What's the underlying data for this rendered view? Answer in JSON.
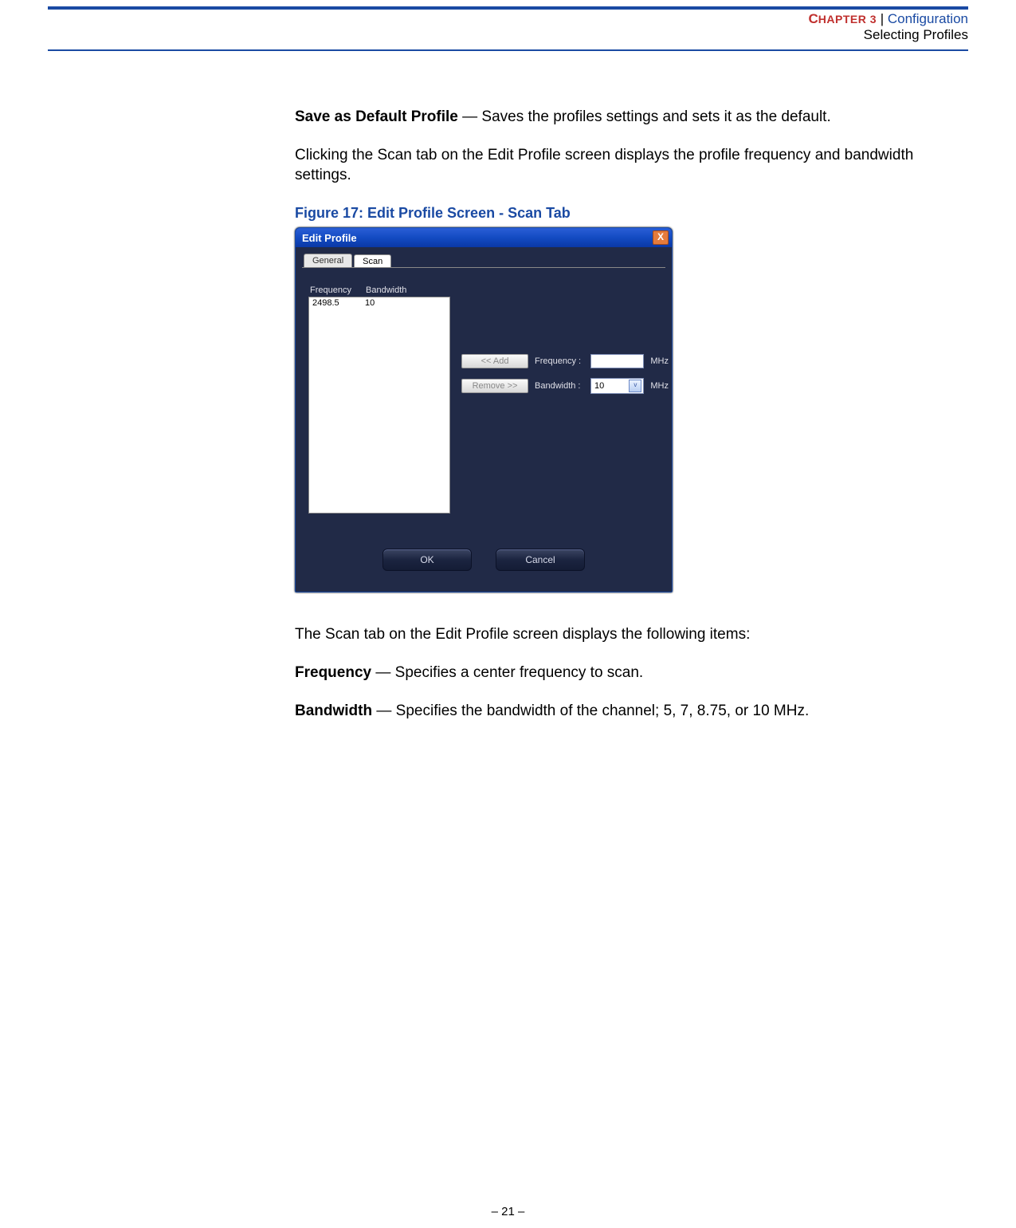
{
  "header": {
    "chapter_word": "C",
    "chapter_rest": "HAPTER 3",
    "sep": "  |  ",
    "config": "Configuration",
    "subtitle": "Selecting Profiles"
  },
  "body": {
    "save_default_term": "Save as Default Profile",
    "save_default_rest": " — Saves the profiles settings and sets it as the default.",
    "scan_intro": "Clicking the Scan tab on the Edit Profile screen displays the profile frequency and bandwidth settings.",
    "fig_caption": "Figure 17:  Edit Profile Screen - Scan Tab",
    "post1": "The Scan tab on the Edit Profile screen displays the following items:",
    "freq_term": "Frequency",
    "freq_rest": " — Specifies a center frequency to scan.",
    "bw_term": "Bandwidth",
    "bw_rest": " — Specifies the bandwidth of the channel; 5, 7, 8.75, or 10 MHz."
  },
  "dialog": {
    "title": "Edit Profile",
    "close_glyph": "X",
    "tabs": {
      "general": "General",
      "scan": "Scan"
    },
    "headers": {
      "freq": "Frequency",
      "bw": "Bandwidth"
    },
    "row": {
      "freq": "2498.5",
      "bw": "10"
    },
    "buttons": {
      "add": "<< Add",
      "remove": "Remove >>",
      "ok": "OK",
      "cancel": "Cancel"
    },
    "labels": {
      "freq": "Frequency :",
      "bw": "Bandwidth :"
    },
    "inputs": {
      "freq_value": "",
      "bw_value": "10"
    },
    "unit": "MHz",
    "select_arrow": "v"
  },
  "footer": {
    "page": "–  21  –"
  }
}
